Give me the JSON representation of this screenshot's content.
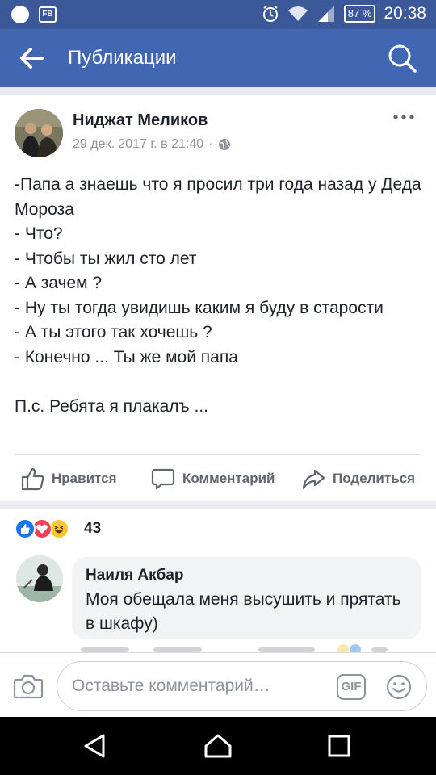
{
  "status_bar": {
    "battery": "87 %",
    "time": "20:38"
  },
  "app_bar": {
    "title": "Публикации"
  },
  "post": {
    "author": "Ниджат Меликов",
    "date": "29 дек. 2017 г. в 21:40",
    "separator": "·",
    "text": "-Папа а знаешь что я просил три года назад у Деда Мороза\n- Что?\n- Чтобы ты жил сто лет\n- А зачем ?\n- Ну ты тогда увидишь каким я буду в старости\n- А ты этого так хочешь ?\n- Конечно ... Ты же мой папа\n\nП.с. Ребята я плакалъ ...",
    "actions": {
      "like": "Нравится",
      "comment": "Комментарий",
      "share": "Поделиться"
    }
  },
  "reactions": {
    "types": [
      "like",
      "love",
      "haha"
    ],
    "count": "43"
  },
  "comment": {
    "author": "Наиля Акбар",
    "text": "Моя обещала меня высушить и прятать в шкафу)"
  },
  "composer": {
    "placeholder": "Оставьте комментарий…",
    "gif_label": "GIF"
  },
  "icons": {
    "back": "arrow-left-icon",
    "search": "search-icon",
    "more": "more-horizontal-icon",
    "globe": "globe-icon",
    "like": "thumbs-up-icon",
    "comment": "comment-bubble-icon",
    "share": "share-arrow-icon",
    "camera": "camera-icon",
    "emoji": "smiley-icon"
  },
  "colors": {
    "brand": "#4267b2",
    "status_bar": "#3b5998",
    "secondary_text": "#90949c",
    "like": "#1877f2",
    "love": "#f33e58",
    "haha": "#f7c72f"
  }
}
